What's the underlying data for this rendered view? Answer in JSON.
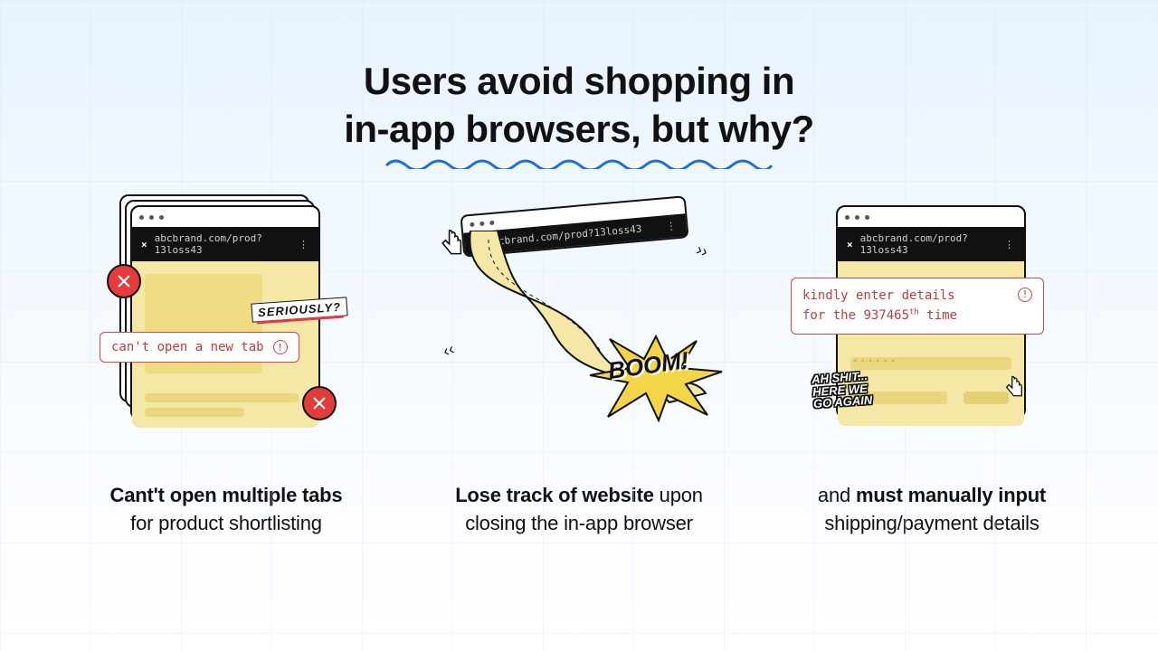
{
  "headline": {
    "line1": "Users avoid shopping in",
    "line2": "in-app browsers, but why?"
  },
  "address_url": "abcbrand.com/prod?13loss43",
  "panel1": {
    "callout_text": "can't open a new tab",
    "sticker": "SERIOUSLY?",
    "caption_bold": "Cant't open multiple tabs",
    "caption_rest": "for product shortlisting"
  },
  "panel2": {
    "boom": "BOOM!",
    "caption_bold": "Lose track of website",
    "caption_rest_a": "upon",
    "caption_rest_b": "closing the in-app browser"
  },
  "panel3": {
    "callout_line1": "kindly enter details",
    "callout_prefix": "for the ",
    "callout_number": "937465",
    "callout_suffix": " time",
    "ordinal": "th",
    "sticker_l1": "ah shit...",
    "sticker_l2": "here we",
    "sticker_l3": "go again",
    "caption_a": "and",
    "caption_bold": "must manually input",
    "caption_rest": "shipping/payment details"
  }
}
